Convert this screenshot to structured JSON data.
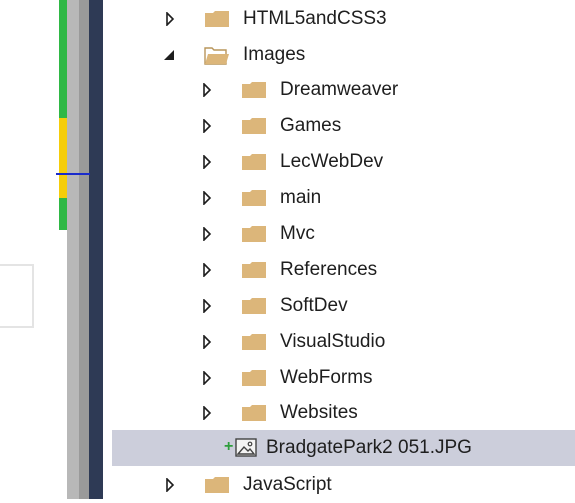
{
  "tree": {
    "items": [
      {
        "label": "HTML5andCSS3",
        "state": "collapsed",
        "icon": "folder-icon"
      },
      {
        "label": "Images",
        "state": "expanded",
        "icon": "folder-open-icon"
      },
      {
        "label": "Dreamweaver",
        "state": "collapsed",
        "icon": "folder-icon"
      },
      {
        "label": "Games",
        "state": "collapsed",
        "icon": "folder-icon"
      },
      {
        "label": "LecWebDev",
        "state": "collapsed",
        "icon": "folder-icon"
      },
      {
        "label": "main",
        "state": "collapsed",
        "icon": "folder-icon"
      },
      {
        "label": "Mvc",
        "state": "collapsed",
        "icon": "folder-icon"
      },
      {
        "label": "References",
        "state": "collapsed",
        "icon": "folder-icon"
      },
      {
        "label": "SoftDev",
        "state": "collapsed",
        "icon": "folder-icon"
      },
      {
        "label": "VisualStudio",
        "state": "collapsed",
        "icon": "folder-icon"
      },
      {
        "label": "WebForms",
        "state": "collapsed",
        "icon": "folder-icon"
      },
      {
        "label": "Websites",
        "state": "collapsed",
        "icon": "folder-icon"
      },
      {
        "label": "BradgatePark2 051.JPG",
        "state": "file",
        "icon": "image-file-icon",
        "badge": "+",
        "selected": true
      },
      {
        "label": "JavaScript",
        "state": "collapsed",
        "icon": "folder-icon"
      }
    ]
  },
  "colors": {
    "folder": "#dcb67a",
    "selection": "#cccedb",
    "added_badge": "#2e9e3c",
    "change_bar_green": "#2fb845",
    "change_bar_yellow": "#f5cd0a"
  }
}
